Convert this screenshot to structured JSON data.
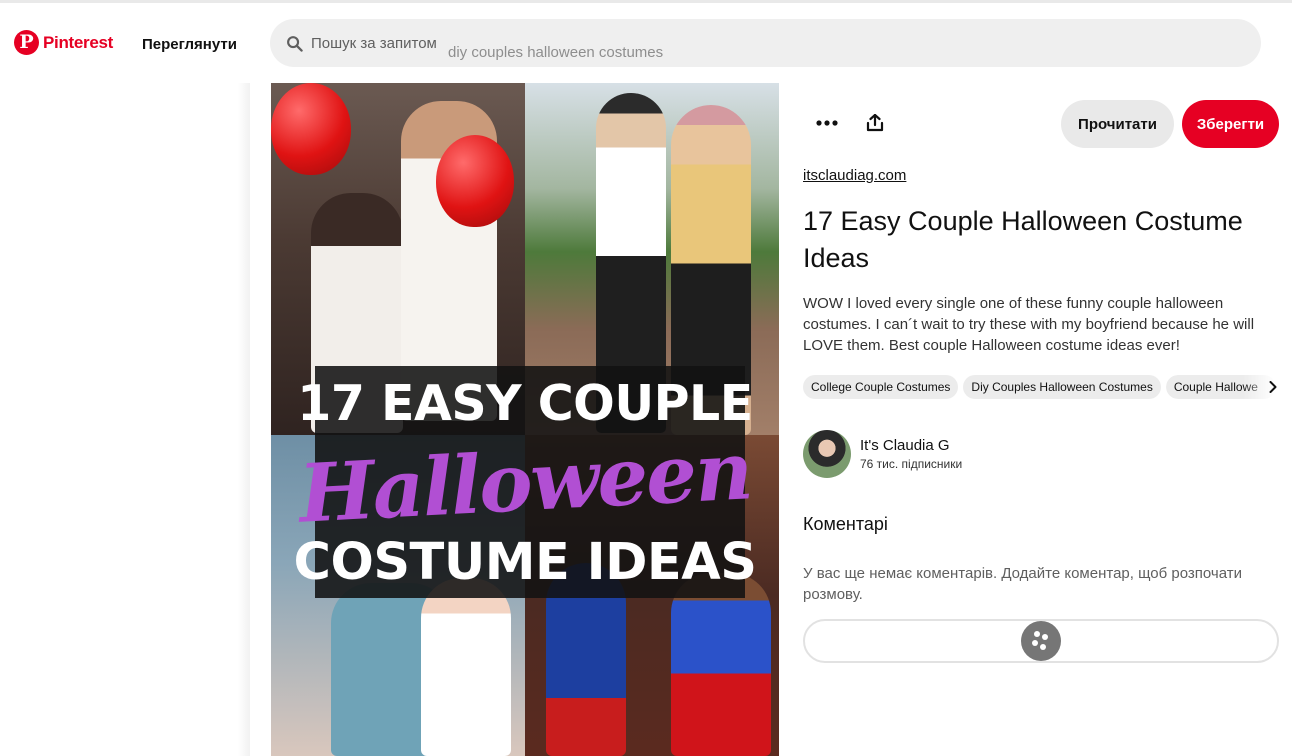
{
  "header": {
    "logo_text": "Pinterest",
    "explore_label": "Переглянути",
    "search_placeholder": "Пошук за запитом",
    "search_query": "diy couples halloween costumes"
  },
  "pin": {
    "image_text": {
      "line1": "17 EASY COUPLE",
      "line2": "Halloween",
      "line3": "COSTUME IDEAS"
    },
    "read_label": "Прочитати",
    "save_label": "Зберегти",
    "source": "itsclaudiag.com",
    "title": "17 Easy Couple Halloween Costume Ideas",
    "description": "WOW I loved every single one of these funny couple halloween costumes. I can´t wait to try these with my boyfriend because he will LOVE them. Best couple Halloween costume ideas ever!",
    "tags": [
      "College Couple Costumes",
      "Diy Couples Halloween Costumes",
      "Couple Hallowe"
    ]
  },
  "author": {
    "name": "It's Claudia G",
    "followers": "76 тис. підписники"
  },
  "comments": {
    "heading": "Коментарі",
    "empty_text": "У вас ще немає коментарів. Додайте коментар, щоб розпочати розмову."
  },
  "colors": {
    "brand": "#e60023",
    "title_accent": "#b14fd3"
  },
  "icons": {
    "logo": "pinterest-logo-icon",
    "search": "search-icon",
    "more": "more-dots-icon",
    "share": "share-icon",
    "tags_next": "chevron-right-icon",
    "loader": "loading-spinner-icon"
  }
}
